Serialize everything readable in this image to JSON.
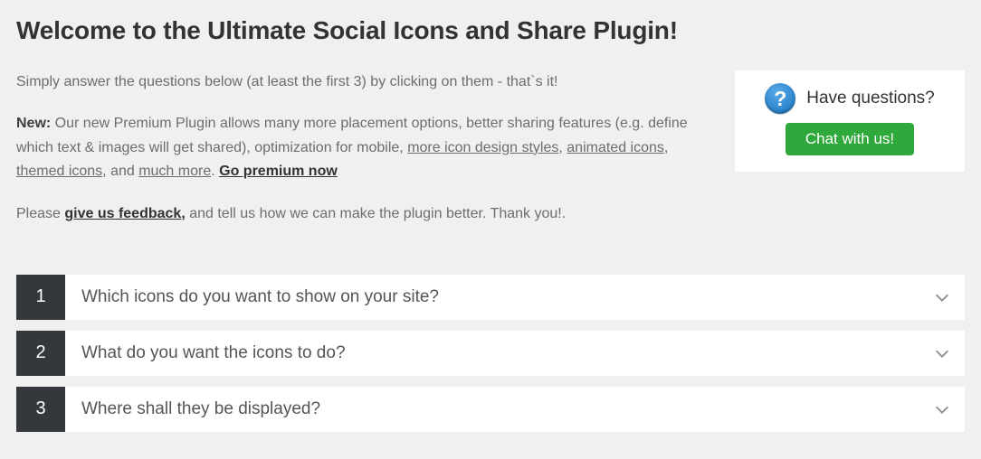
{
  "title": "Welcome to the Ultimate Social Icons and Share Plugin!",
  "intro": "Simply answer the questions below (at least the first 3) by clicking on them - that`s it!",
  "new_block": {
    "label": "New:",
    "part1": " Our new Premium Plugin allows many more placement options, better sharing features (e.g. define which text & images will get shared), optimization for mobile, ",
    "link_styles": "more icon design styles",
    "sep1": ", ",
    "link_animated": "animated icons",
    "sep2": ", ",
    "link_themed": "themed icons",
    "sep3": ", and ",
    "link_more": "much more",
    "sep4": ". ",
    "link_premium": "Go premium now"
  },
  "feedback": {
    "prefix": "Please ",
    "link": "give us feedback,",
    "suffix": " and tell us how we can make the plugin better. Thank you!."
  },
  "help": {
    "title": "Have questions?",
    "button": "Chat with us!"
  },
  "accordion": [
    {
      "num": "1",
      "label": "Which icons do you want to show on your site?"
    },
    {
      "num": "2",
      "label": "What do you want the icons to do?"
    },
    {
      "num": "3",
      "label": "Where shall they be displayed?"
    }
  ]
}
